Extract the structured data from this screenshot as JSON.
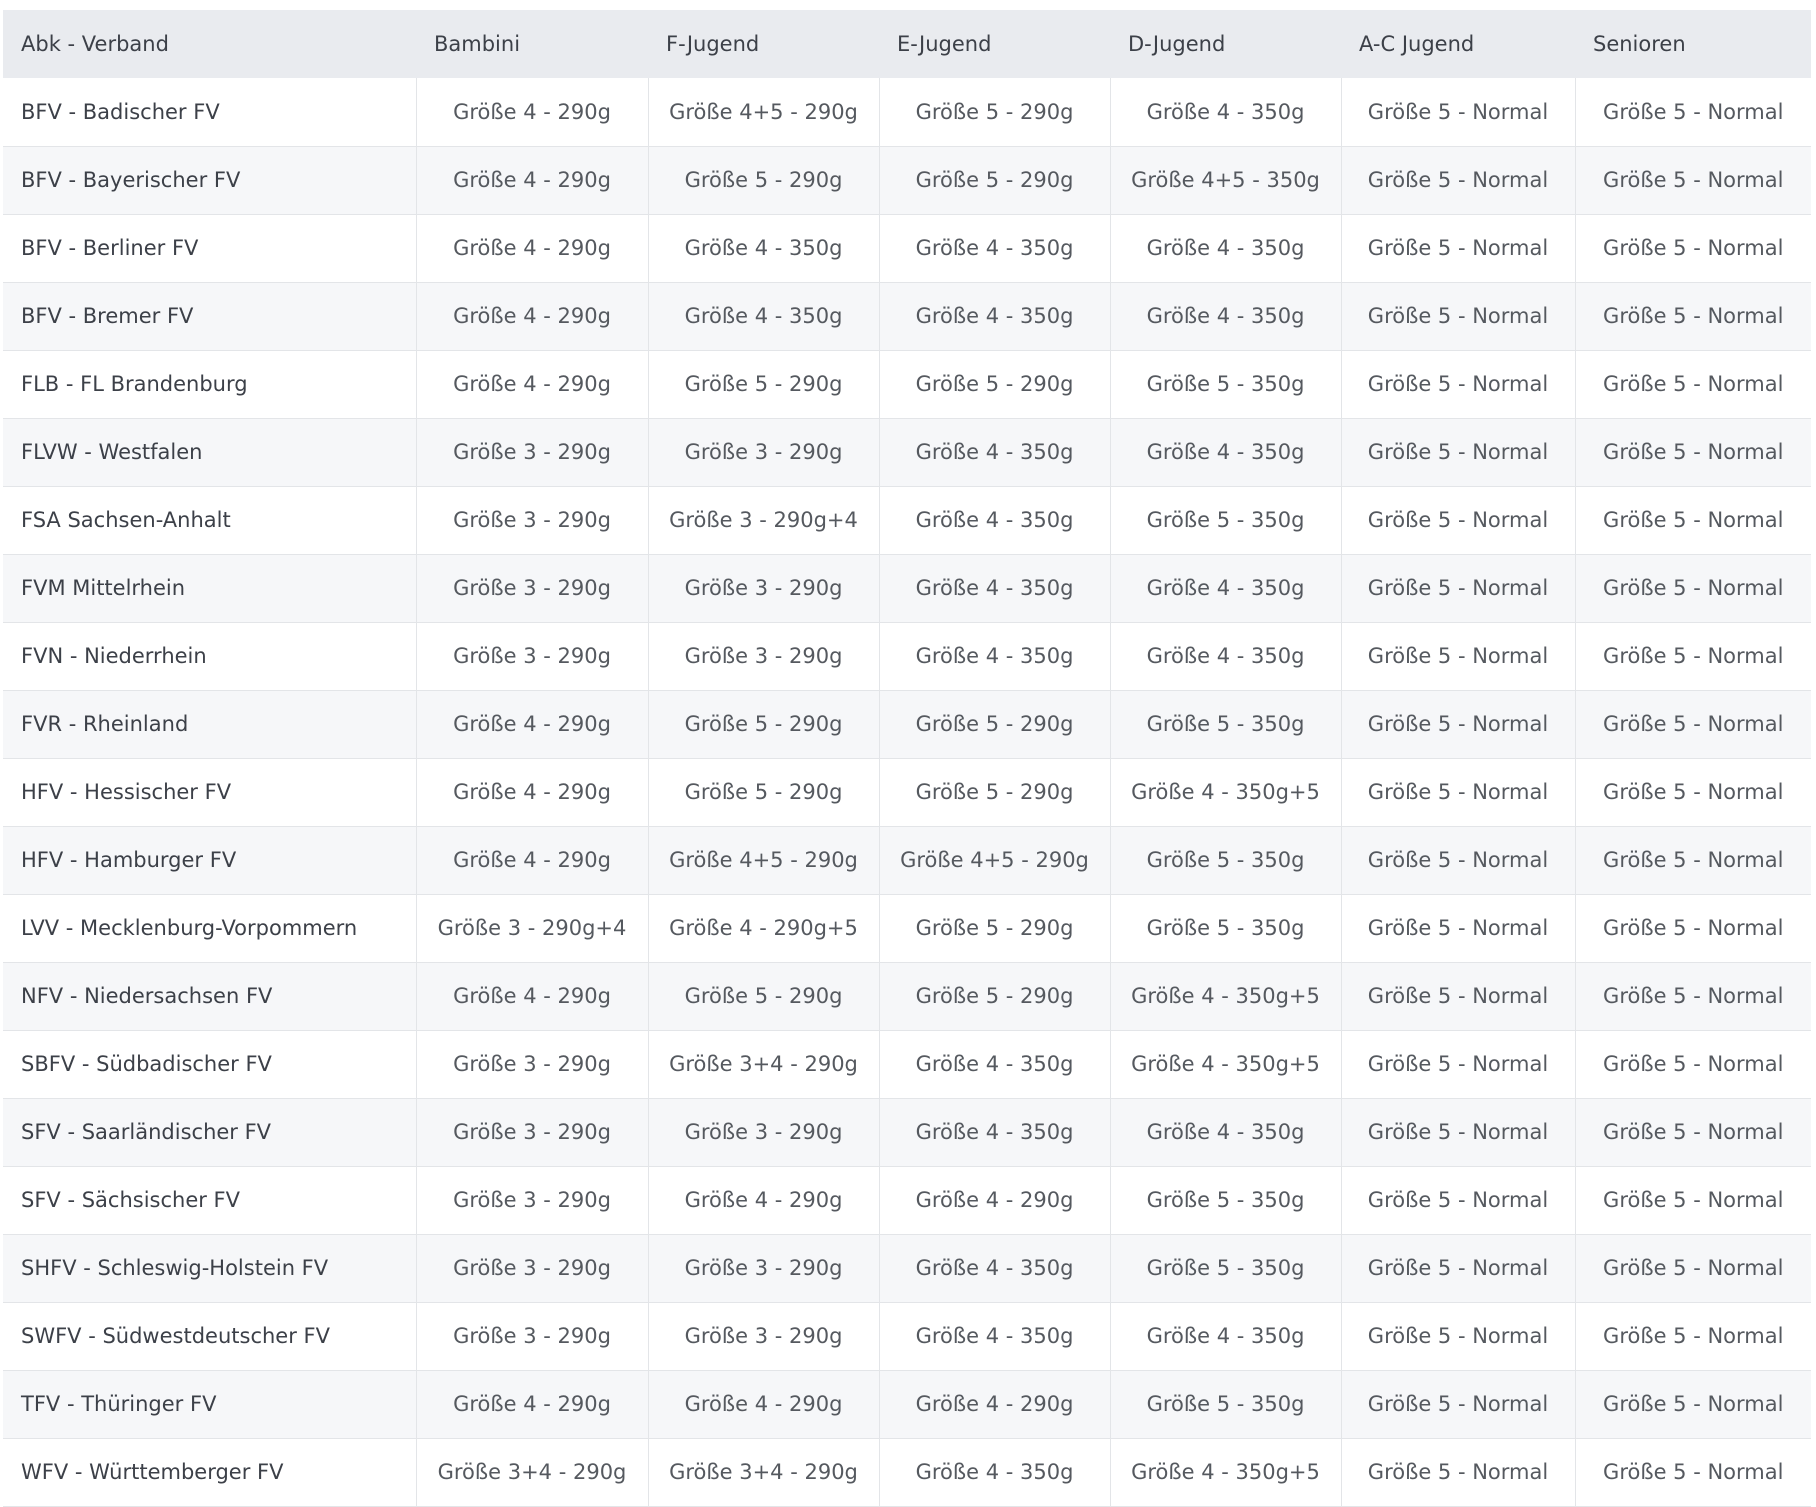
{
  "table": {
    "headers": [
      "Abk - Verband",
      "Bambini",
      "F-Jugend",
      "E-Jugend",
      "D-Jugend",
      "A-C Jugend",
      "Senioren"
    ],
    "rows": [
      [
        "BFV - Badischer FV",
        "Größe 4 - 290g",
        "Größe 4+5 - 290g",
        "Größe 5 - 290g",
        "Größe 4 - 350g",
        "Größe 5 - Normal",
        "Größe 5 - Normal"
      ],
      [
        "BFV - Bayerischer FV",
        "Größe 4 - 290g",
        "Größe 5 - 290g",
        "Größe 5 - 290g",
        "Größe 4+5 - 350g",
        "Größe 5 - Normal",
        "Größe 5 - Normal"
      ],
      [
        "BFV - Berliner FV",
        "Größe 4 - 290g",
        "Größe 4 - 350g",
        "Größe 4 - 350g",
        "Größe 4 - 350g",
        "Größe 5 - Normal",
        "Größe 5 - Normal"
      ],
      [
        "BFV - Bremer FV",
        "Größe 4 - 290g",
        "Größe 4 - 350g",
        "Größe 4 - 350g",
        "Größe 4 - 350g",
        "Größe 5 - Normal",
        "Größe 5 - Normal"
      ],
      [
        "FLB - FL Brandenburg",
        "Größe 4 - 290g",
        "Größe 5 - 290g",
        "Größe 5 - 290g",
        "Größe 5 - 350g",
        "Größe 5 - Normal",
        "Größe 5 - Normal"
      ],
      [
        "FLVW - Westfalen",
        "Größe 3 - 290g",
        "Größe 3 - 290g",
        "Größe 4 - 350g",
        "Größe 4 - 350g",
        "Größe 5 - Normal",
        "Größe 5 - Normal"
      ],
      [
        "FSA Sachsen-Anhalt",
        "Größe 3 - 290g",
        "Größe 3 - 290g+4",
        "Größe 4 - 350g",
        "Größe 5 - 350g",
        "Größe 5 - Normal",
        "Größe 5 - Normal"
      ],
      [
        "FVM Mittelrhein",
        "Größe 3 - 290g",
        "Größe 3 - 290g",
        "Größe 4 - 350g",
        "Größe 4 - 350g",
        "Größe 5 - Normal",
        "Größe 5 - Normal"
      ],
      [
        "FVN - Niederrhein",
        "Größe 3 - 290g",
        "Größe 3 - 290g",
        "Größe 4 - 350g",
        "Größe 4 - 350g",
        "Größe 5 - Normal",
        "Größe 5 - Normal"
      ],
      [
        "FVR - Rheinland",
        "Größe 4 - 290g",
        "Größe 5 - 290g",
        "Größe 5 - 290g",
        "Größe 5 - 350g",
        "Größe 5 - Normal",
        "Größe 5 - Normal"
      ],
      [
        "HFV - Hessischer FV",
        "Größe 4 - 290g",
        "Größe 5 - 290g",
        "Größe 5 - 290g",
        "Größe 4 - 350g+5",
        "Größe 5 - Normal",
        "Größe 5 - Normal"
      ],
      [
        "HFV - Hamburger FV",
        "Größe 4 - 290g",
        "Größe 4+5 - 290g",
        "Größe 4+5 - 290g",
        "Größe 5 - 350g",
        "Größe 5 - Normal",
        "Größe 5 - Normal"
      ],
      [
        "LVV - Mecklenburg-Vorpommern",
        "Größe 3 - 290g+4",
        "Größe 4 - 290g+5",
        "Größe 5 - 290g",
        "Größe 5 - 350g",
        "Größe 5 - Normal",
        "Größe 5 - Normal"
      ],
      [
        "NFV - Niedersachsen FV",
        "Größe 4 - 290g",
        "Größe 5 - 290g",
        "Größe 5 - 290g",
        "Größe 4 - 350g+5",
        "Größe 5 - Normal",
        "Größe 5 - Normal"
      ],
      [
        "SBFV - Südbadischer FV",
        "Größe 3 - 290g",
        "Größe 3+4 - 290g",
        "Größe 4 - 350g",
        "Größe 4 - 350g+5",
        "Größe 5 - Normal",
        "Größe 5 - Normal"
      ],
      [
        "SFV - Saarländischer FV",
        "Größe 3 - 290g",
        "Größe 3 - 290g",
        "Größe 4 - 350g",
        "Größe 4 - 350g",
        "Größe 5 - Normal",
        "Größe 5 - Normal"
      ],
      [
        "SFV - Sächsischer FV",
        "Größe 3 - 290g",
        "Größe 4 - 290g",
        "Größe 4 - 290g",
        "Größe 5 - 350g",
        "Größe 5 - Normal",
        "Größe 5 - Normal"
      ],
      [
        "SHFV - Schleswig-Holstein FV",
        "Größe 3 - 290g",
        "Größe 3 - 290g",
        "Größe 4 - 350g",
        "Größe 5 - 350g",
        "Größe 5 - Normal",
        "Größe 5 - Normal"
      ],
      [
        "SWFV - Südwestdeutscher FV",
        "Größe 3 - 290g",
        "Größe 3 - 290g",
        "Größe 4 - 350g",
        "Größe 4 - 350g",
        "Größe 5 - Normal",
        "Größe 5 - Normal"
      ],
      [
        "TFV - Thüringer FV",
        "Größe 4 - 290g",
        "Größe 4 - 290g",
        "Größe 4 - 290g",
        "Größe 5 - 350g",
        "Größe 5 - Normal",
        "Größe 5 - Normal"
      ],
      [
        "WFV - Württemberger FV",
        "Größe 3+4 - 290g",
        "Größe 3+4 - 290g",
        "Größe 4 - 350g",
        "Größe 4 - 350g+5",
        "Größe 5 - Normal",
        "Größe 5 - Normal"
      ]
    ]
  }
}
